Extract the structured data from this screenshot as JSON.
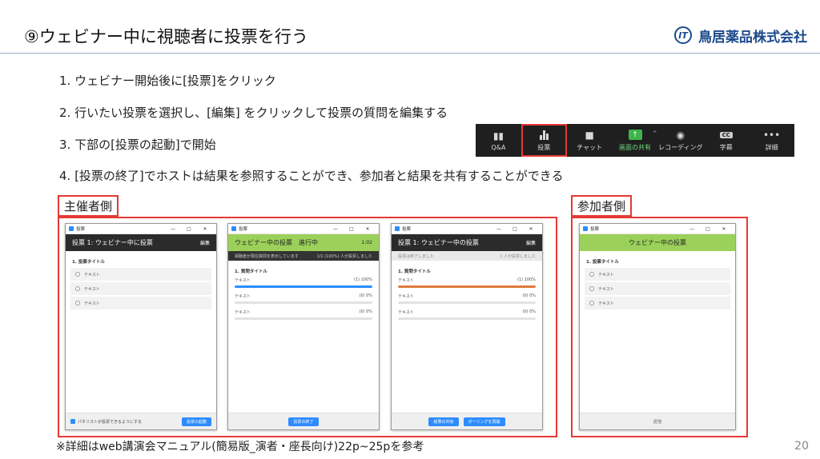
{
  "title": "⑨ウェビナー中に視聴者に投票を行う",
  "logo": {
    "mark": "IT",
    "text": "鳥居薬品株式会社"
  },
  "steps": [
    "1. ウェビナー開始後に[投票]をクリック",
    "2. 行いたい投票を選択し、[編集] をクリックして投票の質問を編集する",
    "3. 下部の[投票の起動]で開始",
    "4. [投票の終了]でホストは結果を参照することができ、参加者と結果を共有することができる"
  ],
  "toolbar": [
    {
      "icon": "qa-icon",
      "label": "Q&A"
    },
    {
      "icon": "poll-icon",
      "label": "投票"
    },
    {
      "icon": "chat-icon",
      "label": "チャット"
    },
    {
      "icon": "share-screen-icon",
      "label": "画面の共有"
    },
    {
      "icon": "record-icon",
      "label": "レコーディング"
    },
    {
      "icon": "cc-icon",
      "label": "字幕",
      "badge": "CC"
    },
    {
      "icon": "more-icon",
      "label": "詳細"
    }
  ],
  "host_label": "主催者側",
  "attendee_label": "参加者側",
  "win_common": {
    "title": "投票",
    "min": "—",
    "max": "□",
    "close": "✕"
  },
  "win1": {
    "header": "投票 1: ウェビナー中に投票",
    "edit": "編集",
    "question": "1. 投票タイトル",
    "options": [
      "テキスト",
      "テキスト",
      "テキスト"
    ],
    "checkbox_label": "パネリストが投票できるようにする",
    "launch_button": "投票の起動"
  },
  "win2": {
    "header": "ウェビナー中の投票　進行中",
    "timer": "1:02",
    "status_left": "視聴者が現在質問を表示しています",
    "status_right": "1/1 (100%) 人が投票しました",
    "question": "1. 質問タイトル",
    "results": [
      {
        "label": "テキスト",
        "value": "(1) 100%",
        "percent": 100
      },
      {
        "label": "テキスト",
        "value": "(0) 0%",
        "percent": 0
      },
      {
        "label": "テキスト",
        "value": "(0) 0%",
        "percent": 0
      }
    ],
    "end_button": "投票の終了"
  },
  "win3": {
    "header": "投票 1: ウェビナー中の投票",
    "edit": "編集",
    "status_left": "投票は終了しました",
    "status_right": "1 人が投票しました",
    "question": "1. 質問タイトル",
    "results": [
      {
        "label": "テキスト",
        "value": "(1) 100%",
        "percent": 100
      },
      {
        "label": "テキスト",
        "value": "(0) 0%",
        "percent": 0
      },
      {
        "label": "テキスト",
        "value": "(0) 0%",
        "percent": 0
      }
    ],
    "share_button": "結果の共有",
    "relaunch_button": "ポーリングを再開"
  },
  "win4": {
    "header": "ウェビナー中の投票",
    "question": "1. 投票タイトル",
    "options": [
      "テキスト",
      "テキスト",
      "テキスト"
    ],
    "submit": "送信"
  },
  "colors": {
    "accent_red": "#e53935",
    "zoom_blue": "#2d8cff",
    "poll_green": "#9bd15a",
    "result_orange": "#e07a3c"
  },
  "note": "※詳細はweb講演会マニュアル(簡易版_演者・座長向け)22p~25pを参考",
  "page_number": "20"
}
